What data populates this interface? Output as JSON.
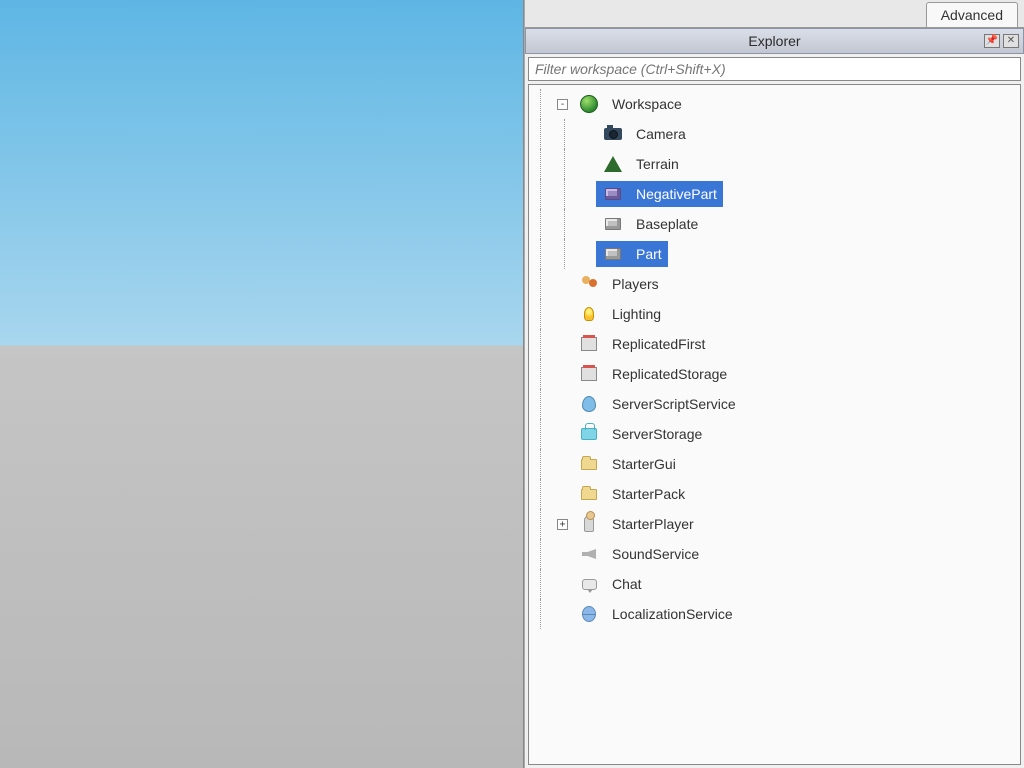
{
  "tabs": {
    "advanced": "Advanced"
  },
  "explorer": {
    "title": "Explorer",
    "pin_char": "📌",
    "close_char": "✕",
    "filter_placeholder": "Filter workspace (Ctrl+Shift+X)"
  },
  "tree": [
    {
      "label": "Workspace",
      "icon": "globe",
      "depth": 0,
      "expander": "-",
      "selected": false
    },
    {
      "label": "Camera",
      "icon": "camera",
      "depth": 1,
      "expander": "",
      "selected": false
    },
    {
      "label": "Terrain",
      "icon": "terrain",
      "depth": 1,
      "expander": "",
      "selected": false
    },
    {
      "label": "NegativePart",
      "icon": "part-dark",
      "depth": 1,
      "expander": "",
      "selected": true
    },
    {
      "label": "Baseplate",
      "icon": "part",
      "depth": 1,
      "expander": "",
      "selected": false
    },
    {
      "label": "Part",
      "icon": "part",
      "depth": 1,
      "expander": "",
      "selected": true
    },
    {
      "label": "Players",
      "icon": "players",
      "depth": 0,
      "expander": "",
      "selected": false
    },
    {
      "label": "Lighting",
      "icon": "lighting",
      "depth": 0,
      "expander": "",
      "selected": false
    },
    {
      "label": "ReplicatedFirst",
      "icon": "repl",
      "depth": 0,
      "expander": "",
      "selected": false
    },
    {
      "label": "ReplicatedStorage",
      "icon": "repl",
      "depth": 0,
      "expander": "",
      "selected": false
    },
    {
      "label": "ServerScriptService",
      "icon": "sss",
      "depth": 0,
      "expander": "",
      "selected": false
    },
    {
      "label": "ServerStorage",
      "icon": "sstore",
      "depth": 0,
      "expander": "",
      "selected": false
    },
    {
      "label": "StarterGui",
      "icon": "folder",
      "depth": 0,
      "expander": "",
      "selected": false
    },
    {
      "label": "StarterPack",
      "icon": "folder",
      "depth": 0,
      "expander": "",
      "selected": false
    },
    {
      "label": "StarterPlayer",
      "icon": "avatar",
      "depth": 0,
      "expander": "+",
      "selected": false
    },
    {
      "label": "SoundService",
      "icon": "sound",
      "depth": 0,
      "expander": "",
      "selected": false
    },
    {
      "label": "Chat",
      "icon": "chat",
      "depth": 0,
      "expander": "",
      "selected": false
    },
    {
      "label": "LocalizationService",
      "icon": "local",
      "depth": 0,
      "expander": "",
      "selected": false
    }
  ],
  "icon_map": {
    "globe": "ic-globe",
    "camera": "ic-camera",
    "terrain": "ic-terrain",
    "part": "ic-part",
    "part-dark": "ic-part dark",
    "players": "ic-players",
    "lighting": "ic-lighting",
    "repl": "ic-repl",
    "sss": "ic-sss",
    "sstore": "ic-sstore",
    "folder": "ic-folder",
    "avatar": "ic-avatar",
    "sound": "ic-sound",
    "chat": "ic-chat",
    "local": "ic-local"
  }
}
